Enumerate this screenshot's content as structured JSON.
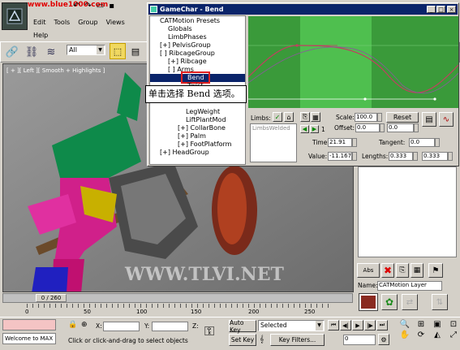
{
  "url_text": "www.blue1000.com",
  "menu": {
    "items": [
      "Edit",
      "Tools",
      "Group",
      "Views"
    ],
    "help": "Help"
  },
  "toolbar": {
    "filter_value": "All"
  },
  "viewport": {
    "label": "[ + ][ Left ][ Smooth + Highlights ]",
    "watermark": "WWW.TLVI.NET"
  },
  "dialog": {
    "title": "GameChar - Bend",
    "tree": [
      "CATMotion Presets",
      "Globals",
      "LimbPhases",
      "[+] PelvisGroup",
      "[ ] RibcageGroup",
      "[+] Ribcage",
      "[ ] Arms",
      "Bend",
      "Twist",
      "LegWeight",
      "LiftPlantMod",
      "[+] CollarBone",
      "[+] Palm",
      "[+] FootPlatform",
      "[+] HeadGroup"
    ],
    "limbs_label": "Limbs:",
    "limbs_list_item": "LimbsWelded",
    "limbs_counter": "1",
    "scale_label": "Scale:",
    "scale_value": "100.0",
    "reset_label": "Reset",
    "offset_label": "Offset:",
    "offset_value_1": "0.0",
    "offset_value_2": "0.0",
    "time_label": "Time:",
    "time_value": "21.91",
    "tangent_label": "Tangent:",
    "tangent_value": "0.0",
    "value_label": "Value:",
    "value_value": "-11.167",
    "lengths_label": "Lengths:",
    "lengths_value_1": "0.333",
    "lengths_value_2": "0.333"
  },
  "callout": {
    "text": "单击选择 Bend 选项。"
  },
  "right_panel": {
    "name_label": "Name:",
    "name_value": "CATMotion Layer",
    "abs_label": "Abs"
  },
  "timeline": {
    "frame_label": "0 / 260",
    "ticks": [
      "0",
      "50",
      "100",
      "150",
      "200",
      "250"
    ]
  },
  "status": {
    "welcome": "Welcome to MAX",
    "prompt": "Click or click-and-drag to select objects",
    "x_label": "X:",
    "y_label": "Y:",
    "z_label": "Z:",
    "autokey": "Auto Key",
    "selected": "Selected",
    "setkey": "Set Key",
    "keyfilters": "Key Filters...",
    "frame_field": "0"
  },
  "colors": {
    "title_bar": "#0a246a",
    "curve_bg": "#3a9a3a",
    "curve_band": "#4fbf4f",
    "curve_line": "#c04060",
    "highlight": "#e02020"
  }
}
